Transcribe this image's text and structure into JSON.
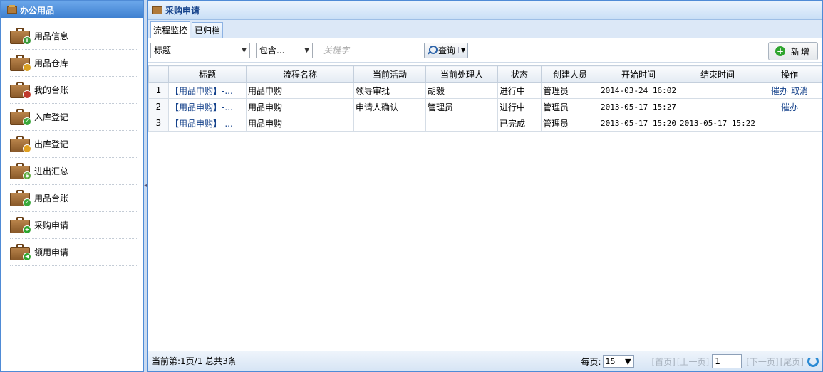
{
  "sidebar": {
    "title": "办公用品",
    "items": [
      {
        "label": "用品信息",
        "badge_color": "#3a9a3a",
        "badge": "i"
      },
      {
        "label": "用品仓库",
        "badge_color": "#d9a020",
        "badge": ""
      },
      {
        "label": "我的台账",
        "badge_color": "#c0392b",
        "badge": ""
      },
      {
        "label": "入库登记",
        "badge_color": "#3aa83a",
        "badge": "✓"
      },
      {
        "label": "出库登记",
        "badge_color": "#e0a020",
        "badge": ""
      },
      {
        "label": "进出汇总",
        "badge_color": "#5aa83a",
        "badge": "$"
      },
      {
        "label": "用品台账",
        "badge_color": "#3aa83a",
        "badge": "✓"
      },
      {
        "label": "采购申请",
        "badge_color": "#2ea52e",
        "badge": "+"
      },
      {
        "label": "领用申请",
        "badge_color": "#2ea52e",
        "badge": "◀"
      }
    ]
  },
  "main": {
    "title": "采购申请",
    "tabs": [
      {
        "label": "流程监控"
      },
      {
        "label": "已归档"
      }
    ],
    "toolbar": {
      "field_select": "标题",
      "op_select": "包含...",
      "keyword_placeholder": "关键字",
      "query_label": "查询",
      "add_label": "新增"
    },
    "table": {
      "headers": [
        "",
        "标题",
        "流程名称",
        "当前活动",
        "当前处理人",
        "状态",
        "创建人员",
        "开始时间",
        "结束时间",
        "操作"
      ],
      "rows": [
        {
          "no": "1",
          "title": "【用品申购】-...",
          "process": "用品申购",
          "activity": "领导审批",
          "handler": "胡毅",
          "status": "进行中",
          "creator": "管理员",
          "start": "2014-03-24 16:02",
          "end": "",
          "ops": [
            "催办",
            "取消"
          ]
        },
        {
          "no": "2",
          "title": "【用品申购】-...",
          "process": "用品申购",
          "activity": "申请人确认",
          "handler": "管理员",
          "status": "进行中",
          "creator": "管理员",
          "start": "2013-05-17 15:27",
          "end": "",
          "ops": [
            "催办"
          ]
        },
        {
          "no": "3",
          "title": "【用品申购】-...",
          "process": "用品申购",
          "activity": "",
          "handler": "",
          "status": "已完成",
          "creator": "管理员",
          "start": "2013-05-17 15:20",
          "end": "2013-05-17 15:22",
          "ops": []
        }
      ]
    },
    "footer": {
      "info": "当前第:1页/1 总共3条",
      "per_page_label": "每页:",
      "per_page": "15",
      "first": "[首页]",
      "prev": "[上一页]",
      "page_input": "1",
      "next": "[下一页]",
      "last": "[尾页]"
    }
  }
}
